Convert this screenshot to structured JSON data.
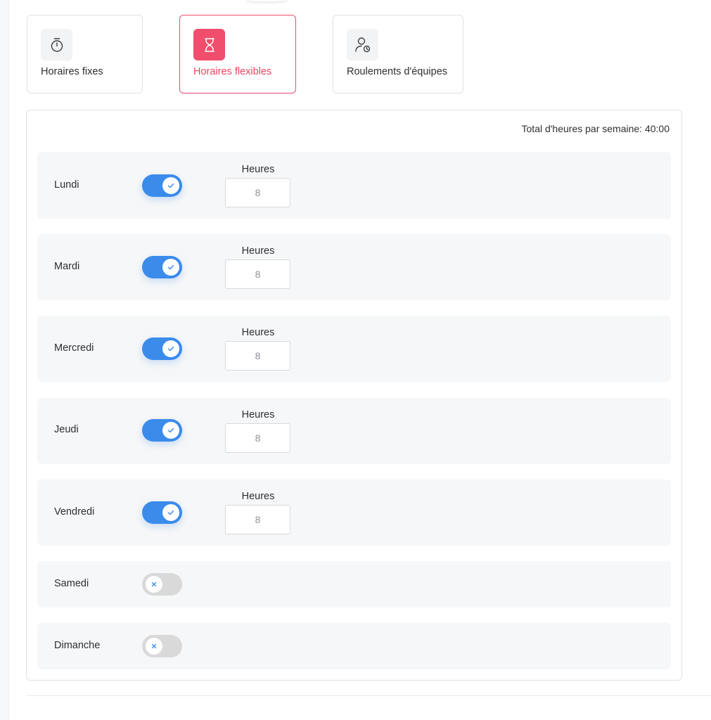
{
  "schedule_types": [
    {
      "label": "Horaires fixes",
      "icon": "stopwatch-icon",
      "active": false
    },
    {
      "label": "Horaires flexibles",
      "icon": "hourglass-icon",
      "active": true
    },
    {
      "label": "Roulements d'équipes",
      "icon": "user-clock-icon",
      "active": false
    }
  ],
  "total_label": "Total d'heures par semaine: 40:00",
  "hours_label": "Heures",
  "days": [
    {
      "name": "Lundi",
      "enabled": true,
      "hours": "8"
    },
    {
      "name": "Mardi",
      "enabled": true,
      "hours": "8"
    },
    {
      "name": "Mercredi",
      "enabled": true,
      "hours": "8"
    },
    {
      "name": "Jeudi",
      "enabled": true,
      "hours": "8"
    },
    {
      "name": "Vendredi",
      "enabled": true,
      "hours": "8"
    },
    {
      "name": "Samedi",
      "enabled": false
    },
    {
      "name": "Dimanche",
      "enabled": false
    }
  ],
  "colors": {
    "accent_active": "#f04e6c",
    "toggle_on": "#3b8beb",
    "toggle_off": "#d9d9d9"
  }
}
